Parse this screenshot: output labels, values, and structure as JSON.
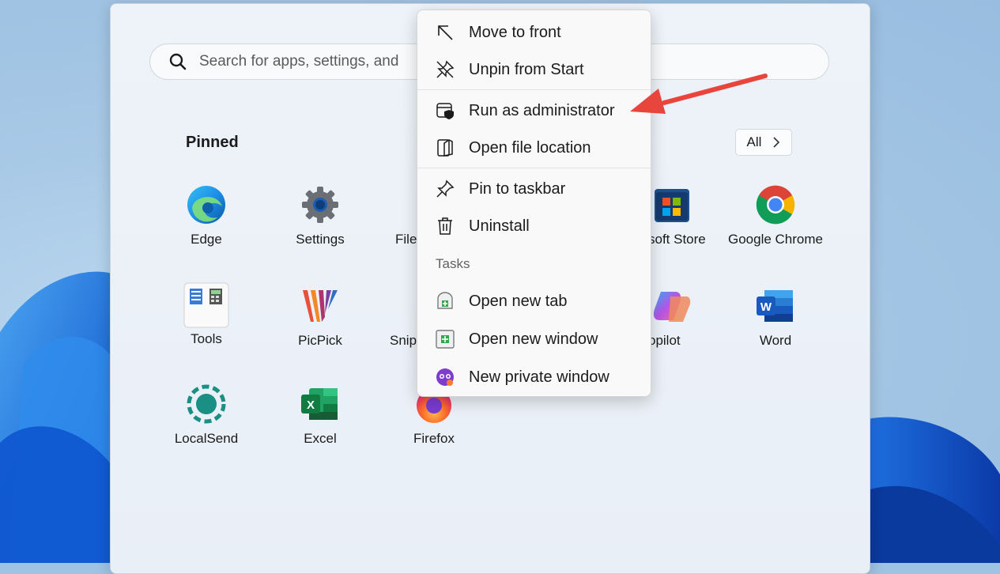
{
  "search": {
    "placeholder": "Search for apps, settings, and",
    "icon": "search-icon"
  },
  "pinned": {
    "heading": "Pinned",
    "all_label": "All",
    "all_icon": "chevron-right-icon"
  },
  "apps": [
    {
      "label": "Edge",
      "icon": "edge-icon"
    },
    {
      "label": "Settings",
      "icon": "gear-icon"
    },
    {
      "label": "File",
      "icon": "folder-icon"
    },
    {
      "label": "soft Store",
      "icon": "store-icon"
    },
    {
      "label": "Google Chrome",
      "icon": "chrome-icon"
    },
    {
      "label": "Tools",
      "icon": "tools-icon"
    },
    {
      "label": "PicPick",
      "icon": "picpick-icon"
    },
    {
      "label": "Snip",
      "icon": "snip-icon"
    },
    {
      "label": "opilot",
      "icon": "copilot-icon"
    },
    {
      "label": "Word",
      "icon": "word-icon"
    },
    {
      "label": "LocalSend",
      "icon": "localsend-icon"
    },
    {
      "label": "Excel",
      "icon": "excel-icon"
    },
    {
      "label": "Firefox",
      "icon": "firefox-icon"
    }
  ],
  "context_menu": {
    "items": [
      {
        "label": "Move to front",
        "icon": "arrow-up-left-icon"
      },
      {
        "label": "Unpin from Start",
        "icon": "unpin-icon"
      },
      {
        "label": "Run as administrator",
        "icon": "admin-shield-icon"
      },
      {
        "label": "Open file location",
        "icon": "file-location-icon"
      },
      {
        "label": "Pin to taskbar",
        "icon": "pin-icon"
      },
      {
        "label": "Uninstall",
        "icon": "trash-icon"
      }
    ],
    "tasks_heading": "Tasks",
    "tasks": [
      {
        "label": "Open new tab",
        "icon": "new-tab-icon"
      },
      {
        "label": "Open new window",
        "icon": "new-window-icon"
      },
      {
        "label": "New private window",
        "icon": "private-window-icon"
      }
    ]
  },
  "annotation": {
    "arrow_color": "#e8453c"
  }
}
